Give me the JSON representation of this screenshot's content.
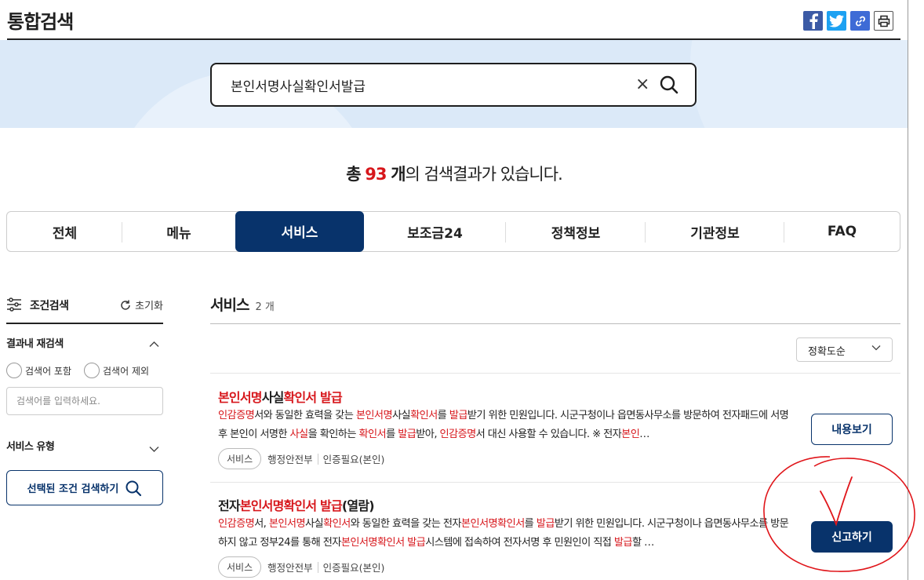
{
  "header": {
    "title": "통합검색",
    "share": [
      "facebook-icon",
      "twitter-icon",
      "link-icon",
      "print-icon"
    ]
  },
  "search": {
    "value": "본인서명사실확인서발급",
    "clear_label": "×"
  },
  "result_count": {
    "prefix": "총",
    "number": "93",
    "unit": "개",
    "suffix": "의 검색결과가 있습니다."
  },
  "tabs": [
    {
      "label": "전체"
    },
    {
      "label": "메뉴"
    },
    {
      "label": "서비스",
      "active": true
    },
    {
      "label": "보조금24"
    },
    {
      "label": "정책정보"
    },
    {
      "label": "기관정보"
    },
    {
      "label": "FAQ"
    }
  ],
  "sidebar": {
    "title": "조건검색",
    "reset": "초기화",
    "refine_title": "결과내 재검색",
    "include_label": "검색어 포함",
    "exclude_label": "검색어 제외",
    "keyword_placeholder": "검색어를 입력하세요.",
    "service_type_title": "서비스 유형",
    "search_button": "선택된 조건 검색하기"
  },
  "main": {
    "section_title": "서비스",
    "section_count": "2 개",
    "sort_label": "정확도순",
    "items": [
      {
        "title_parts": [
          [
            "본인서명",
            true
          ],
          [
            "사실",
            false
          ],
          [
            "확인서 발급",
            true
          ]
        ],
        "desc_parts": [
          [
            "인감증명",
            true
          ],
          [
            "서와 동일한 효력을 갖는 ",
            false
          ],
          [
            "본인서명",
            true
          ],
          [
            "사실",
            false
          ],
          [
            "확인서",
            true
          ],
          [
            "를 ",
            false
          ],
          [
            "발급",
            true
          ],
          [
            "받기 위한 민원입니다. 시군구청이나 읍면동사무소를 방문하여 전자패드에 서명 후 본인이 서명한 ",
            false
          ],
          [
            "사실",
            true
          ],
          [
            "을 확인하는 ",
            false
          ],
          [
            "확인서",
            true
          ],
          [
            "를 ",
            false
          ],
          [
            "발급",
            true
          ],
          [
            "받아, ",
            false
          ],
          [
            "인감증명",
            true
          ],
          [
            "서 대신 사용할 수 있습니다. ※ 전자",
            false
          ],
          [
            "본인",
            true
          ],
          [
            "…",
            false
          ]
        ],
        "tag": "서비스",
        "org": "행정안전부",
        "auth": "인증필요(본인)",
        "button": "내용보기"
      },
      {
        "title_parts": [
          [
            "전자",
            false
          ],
          [
            "본인서명확인서 발급",
            true
          ],
          [
            "(열람)",
            false
          ]
        ],
        "desc_parts": [
          [
            "인감증명",
            true
          ],
          [
            "서, ",
            false
          ],
          [
            "본인서명",
            true
          ],
          [
            "사실",
            false
          ],
          [
            "확인서",
            true
          ],
          [
            "와 동일한 효력을 갖는 전자",
            false
          ],
          [
            "본인서명확인서",
            true
          ],
          [
            "를 ",
            false
          ],
          [
            "발급",
            true
          ],
          [
            "받기 위한 민원입니다. 시군구청이나 읍면동사무소를 방문하지 않고 정부24를 통해 전자",
            false
          ],
          [
            "본인서명확인서 발급",
            true
          ],
          [
            "시스템에 접속하여 전자서명 후 민원인이 직접 ",
            false
          ],
          [
            "발급",
            true
          ],
          [
            "할 …",
            false
          ]
        ],
        "tag": "서비스",
        "org": "행정안전부",
        "auth": "인증필요(본인)",
        "button": "신고하기"
      }
    ]
  },
  "colors": {
    "primary": "#08336b",
    "highlight": "#d7161b",
    "hero_bg": "#dbe9f8",
    "annotation": "#e0161b"
  }
}
